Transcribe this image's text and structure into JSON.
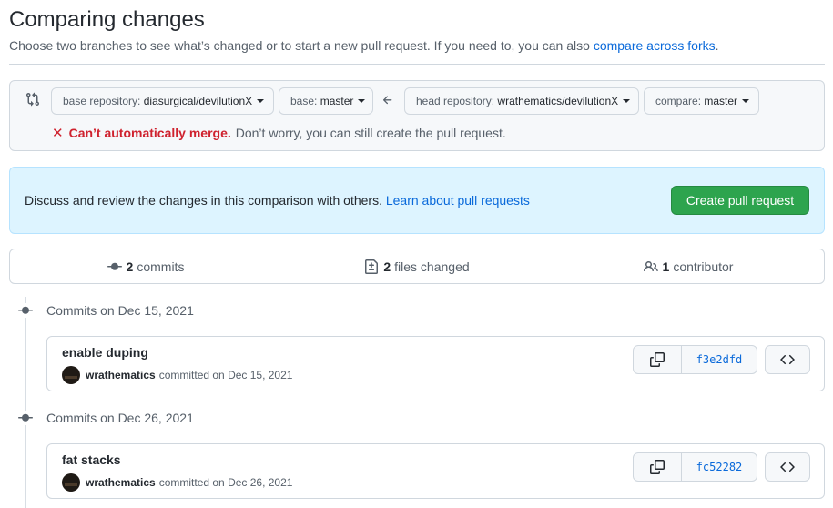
{
  "header": {
    "title": "Comparing changes",
    "subtitle_text": "Choose two branches to see what’s changed or to start a new pull request. If you need to, you can also ",
    "subtitle_link": "compare across forks",
    "subtitle_end": "."
  },
  "range": {
    "base_repo_label": "base repository: ",
    "base_repo_value": "diasurgical/devilutionX",
    "base_label": "base: ",
    "base_value": "master",
    "head_repo_label": "head repository: ",
    "head_repo_value": "wrathematics/devilutionX",
    "compare_label": "compare: ",
    "compare_value": "master",
    "merge_status": "Can’t automatically merge.",
    "merge_note": "Don’t worry, you can still create the pull request."
  },
  "flash": {
    "text": "Discuss and review the changes in this comparison with others. ",
    "link": "Learn about pull requests",
    "button": "Create pull request"
  },
  "overview": {
    "commits_count": "2",
    "commits_label": "commits",
    "files_count": "2",
    "files_label": "files changed",
    "contributors_count": "1",
    "contributors_label": "contributor"
  },
  "timeline": [
    {
      "date_heading": "Commits on Dec 15, 2021",
      "message": "enable duping",
      "author": "wrathematics",
      "action": "committed on Dec 15, 2021",
      "sha": "f3e2dfd"
    },
    {
      "date_heading": "Commits on Dec 26, 2021",
      "message": "fat stacks",
      "author": "wrathematics",
      "action": "committed on Dec 26, 2021",
      "sha": "fc52282"
    }
  ],
  "colors": {
    "link": "#0969da",
    "error": "#cf222e",
    "primary_button": "#2da44e",
    "flash_bg": "#ddf4ff"
  }
}
